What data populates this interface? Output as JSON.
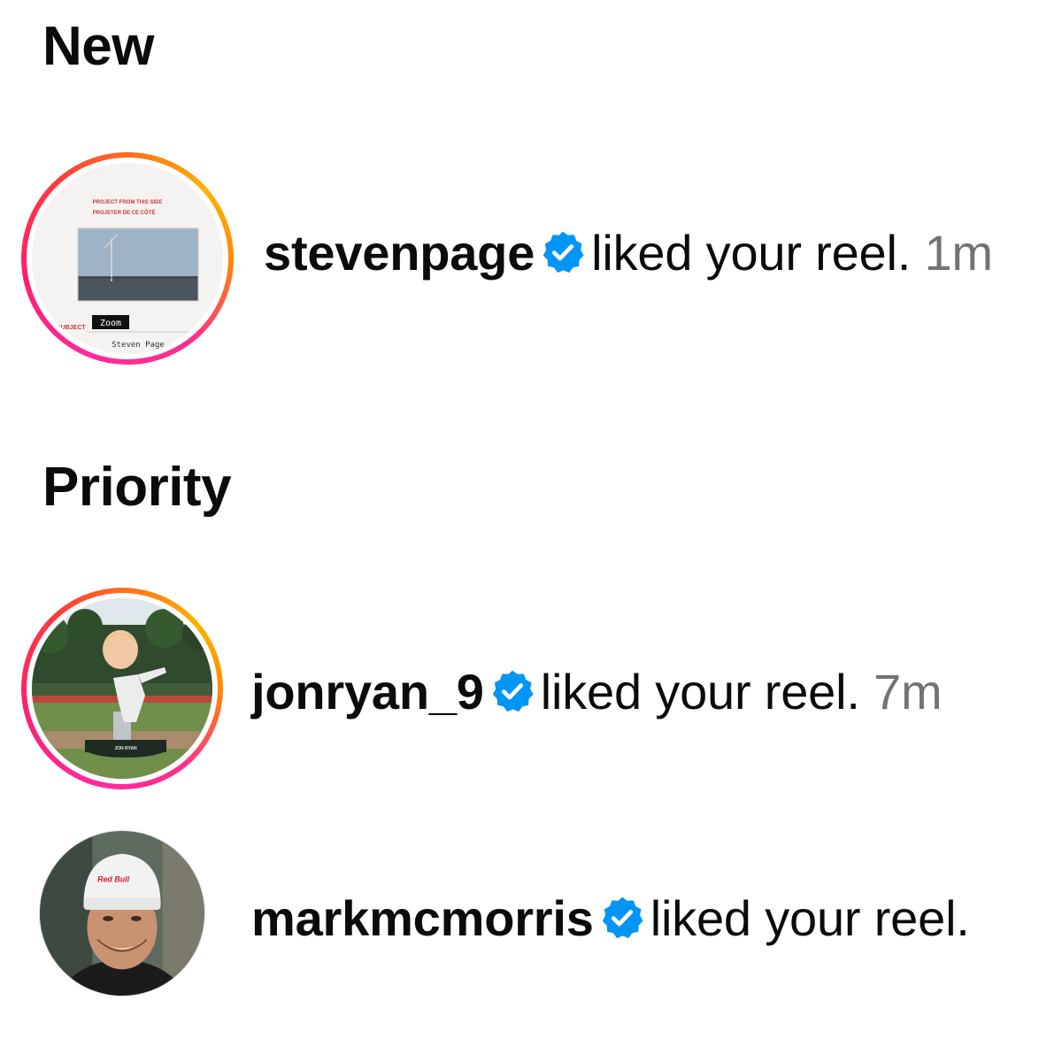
{
  "sections": {
    "new_title": "New",
    "priority_title": "Priority"
  },
  "notifications": [
    {
      "username": "stevenpage",
      "verified": true,
      "action": "liked your reel.",
      "time": "1m",
      "avatar_ring": true,
      "avatar_text": {
        "line1": "PROJECT FROM THIS SIDE",
        "line2": "PROJETER DE CE CÔTÉ",
        "left": "SUBJECT",
        "zoom": "Zoom",
        "name": "Steven Page"
      }
    },
    {
      "username": "jonryan_9",
      "verified": true,
      "action": "liked your reel.",
      "time": "7m",
      "avatar_ring": true,
      "avatar_text": {
        "base": "JON RYAN"
      }
    },
    {
      "username": "markmcmorris",
      "verified": true,
      "action": "liked your reel.",
      "time": "",
      "avatar_ring": false,
      "avatar_text": {
        "beanie": "Red Bull"
      }
    }
  ],
  "icons": {
    "verified": "verified-badge-icon"
  },
  "colors": {
    "verified_blue": "#0095f6",
    "time_gray": "#737373",
    "text": "#0b0b0b"
  }
}
